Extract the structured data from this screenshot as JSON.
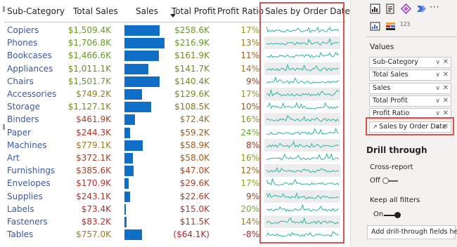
{
  "table": {
    "headers": {
      "sub_category": "Sub-Category",
      "total_sales": "Total Sales",
      "sales": "Sales",
      "total_profit": "Total Profit",
      "profit_ratio": "Profit Ratio",
      "sales_by_order_date": "Sales by Order Date"
    },
    "rows": [
      {
        "name": "Copiers",
        "total_sales": "$1,509.4K",
        "sales": 1509.4,
        "total_profit": "$258.6K",
        "profit_ratio": "17%",
        "ts_color": "#6a9a2a",
        "tp_color": "#6a9a2a",
        "pr_color": "#8aa424"
      },
      {
        "name": "Phones",
        "total_sales": "$1,706.8K",
        "sales": 1706.8,
        "total_profit": "$216.9K",
        "profit_ratio": "13%",
        "ts_color": "#6a9a2a",
        "tp_color": "#6a9a2a",
        "pr_color": "#a07a20"
      },
      {
        "name": "Bookcases",
        "total_sales": "$1,466.6K",
        "sales": 1466.6,
        "total_profit": "$161.9K",
        "profit_ratio": "11%",
        "ts_color": "#6a9a2a",
        "tp_color": "#7a8a22",
        "pr_color": "#a05a20"
      },
      {
        "name": "Appliances",
        "total_sales": "$1,011.1K",
        "sales": 1011.1,
        "total_profit": "$141.7K",
        "profit_ratio": "14%",
        "ts_color": "#7a8a22",
        "tp_color": "#7a8a22",
        "pr_color": "#a07a20"
      },
      {
        "name": "Chairs",
        "total_sales": "$1,501.7K",
        "sales": 1501.7,
        "total_profit": "$140.4K",
        "profit_ratio": "9%",
        "ts_color": "#6a9a2a",
        "tp_color": "#7a8a22",
        "pr_color": "#a04020"
      },
      {
        "name": "Accessories",
        "total_sales": "$749.2K",
        "sales": 749.2,
        "total_profit": "$129.6K",
        "profit_ratio": "17%",
        "ts_color": "#a07a20",
        "tp_color": "#7a8a22",
        "pr_color": "#8aa424"
      },
      {
        "name": "Storage",
        "total_sales": "$1,127.1K",
        "sales": 1127.1,
        "total_profit": "$108.5K",
        "profit_ratio": "10%",
        "ts_color": "#7a8a22",
        "tp_color": "#8a7a22",
        "pr_color": "#a05a20"
      },
      {
        "name": "Binders",
        "total_sales": "$461.9K",
        "sales": 461.9,
        "total_profit": "$72.4K",
        "profit_ratio": "16%",
        "ts_color": "#a8402a",
        "tp_color": "#a06a20",
        "pr_color": "#8a9a24"
      },
      {
        "name": "Paper",
        "total_sales": "$244.3K",
        "sales": 244.3,
        "total_profit": "$59.2K",
        "profit_ratio": "24%",
        "ts_color": "#b8302a",
        "tp_color": "#a05a20",
        "pr_color": "#6aaa2a"
      },
      {
        "name": "Machines",
        "total_sales": "$779.1K",
        "sales": 779.1,
        "total_profit": "$58.9K",
        "profit_ratio": "8%",
        "ts_color": "#a07a20",
        "tp_color": "#a05a20",
        "pr_color": "#a03020"
      },
      {
        "name": "Art",
        "total_sales": "$372.1K",
        "sales": 372.1,
        "total_profit": "$58.0K",
        "profit_ratio": "16%",
        "ts_color": "#a8402a",
        "tp_color": "#a05a20",
        "pr_color": "#8a9a24"
      },
      {
        "name": "Furnishings",
        "total_sales": "$385.6K",
        "sales": 385.6,
        "total_profit": "$47.0K",
        "profit_ratio": "12%",
        "ts_color": "#a8402a",
        "tp_color": "#a84a22",
        "pr_color": "#a06a20"
      },
      {
        "name": "Envelopes",
        "total_sales": "$170.9K",
        "sales": 170.9,
        "total_profit": "$29.6K",
        "profit_ratio": "17%",
        "ts_color": "#b8302a",
        "tp_color": "#a8402a",
        "pr_color": "#8aa424"
      },
      {
        "name": "Supplies",
        "total_sales": "$243.1K",
        "sales": 243.1,
        "total_profit": "$22.6K",
        "profit_ratio": "9%",
        "ts_color": "#b8302a",
        "tp_color": "#a8402a",
        "pr_color": "#a04020"
      },
      {
        "name": "Labels",
        "total_sales": "$73.4K",
        "sales": 73.4,
        "total_profit": "$15.0K",
        "profit_ratio": "20%",
        "ts_color": "#c0282a",
        "tp_color": "#b0382a",
        "pr_color": "#7aaa2a"
      },
      {
        "name": "Fasteners",
        "total_sales": "$83.2K",
        "sales": 83.2,
        "total_profit": "$11.5K",
        "profit_ratio": "14%",
        "ts_color": "#c0282a",
        "tp_color": "#b0382a",
        "pr_color": "#a07a20"
      },
      {
        "name": "Tables",
        "total_sales": "$757.0K",
        "sales": 757.0,
        "total_profit": "($64.1K)",
        "profit_ratio": "-8%",
        "ts_color": "#a07a20",
        "tp_color": "#c0202a",
        "pr_color": "#c0202a"
      }
    ],
    "bar_color": "#0f6fc6",
    "sparkline_color": "#2ab5a5"
  },
  "pane": {
    "more_label": "···",
    "values_title": "Values",
    "wells": [
      {
        "label": "Sub-Category"
      },
      {
        "label": "Total Sales"
      },
      {
        "label": "Sales"
      },
      {
        "label": "Total Profit"
      },
      {
        "label": "Profit Ratio"
      },
      {
        "label": "Sales by Order Date"
      }
    ],
    "drill_through_title": "Drill through",
    "cross_report_label": "Cross-report",
    "cross_report_state": "Off",
    "keep_filters_label": "Keep all filters",
    "keep_filters_state": "On",
    "add_fields_label": "Add drill-through fields here",
    "icon_123": "123"
  }
}
